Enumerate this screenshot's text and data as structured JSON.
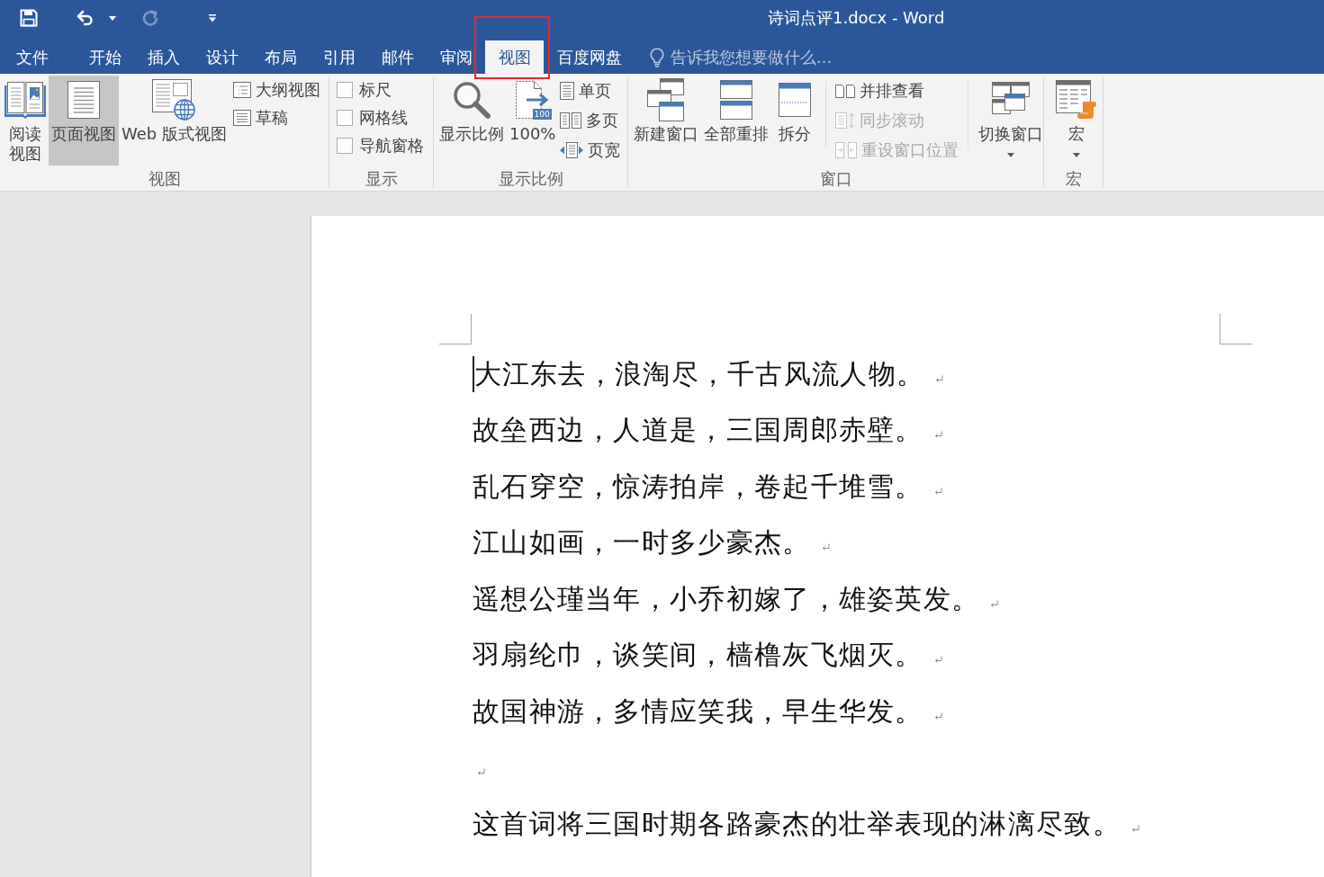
{
  "window": {
    "title": "诗词点评1.docx - Word"
  },
  "quick_access": [
    {
      "disabled": false
    },
    {
      "disabled": false
    },
    {
      "disabled": true
    }
  ],
  "tabs": [
    {
      "label": "文件",
      "selected": false,
      "highlighted": false
    },
    {
      "label": "开始",
      "selected": false,
      "highlighted": false
    },
    {
      "label": "插入",
      "selected": false,
      "highlighted": false
    },
    {
      "label": "设计",
      "selected": false,
      "highlighted": false
    },
    {
      "label": "布局",
      "selected": false,
      "highlighted": false
    },
    {
      "label": "引用",
      "selected": false,
      "highlighted": false
    },
    {
      "label": "邮件",
      "selected": false,
      "highlighted": false
    },
    {
      "label": "审阅",
      "selected": false,
      "highlighted": false
    },
    {
      "label": "视图",
      "selected": true,
      "highlighted": true
    },
    {
      "label": "百度网盘",
      "selected": false,
      "highlighted": false
    }
  ],
  "tell_me": {
    "placeholder": "告诉我您想要做什么..."
  },
  "ribbon": {
    "groups": [
      {
        "label": "视图",
        "items": [
          {
            "kind": "large",
            "label": "阅读视图",
            "selected": false
          },
          {
            "kind": "large",
            "label": "页面视图",
            "selected": true
          },
          {
            "kind": "large",
            "label": "Web 版式视图",
            "selected": false
          },
          {
            "kind": "small",
            "label": "大纲视图",
            "selected": false
          },
          {
            "kind": "small",
            "label": "草稿",
            "selected": false
          }
        ]
      },
      {
        "label": "显示",
        "items": [
          {
            "kind": "checkbox",
            "label": "标尺",
            "checked": false
          },
          {
            "kind": "checkbox",
            "label": "网格线",
            "checked": false
          },
          {
            "kind": "checkbox",
            "label": "导航窗格",
            "checked": false
          }
        ]
      },
      {
        "label": "显示比例",
        "items": [
          {
            "kind": "large",
            "label": "显示比例"
          },
          {
            "kind": "large",
            "label": "100%",
            "badge": "100"
          },
          {
            "kind": "small",
            "label": "单页"
          },
          {
            "kind": "small",
            "label": "多页"
          },
          {
            "kind": "small",
            "label": "页宽"
          }
        ]
      },
      {
        "label": "窗口",
        "items": [
          {
            "kind": "large",
            "label": "新建窗口",
            "disabled": false
          },
          {
            "kind": "large",
            "label": "全部重排",
            "disabled": false
          },
          {
            "kind": "large",
            "label": "拆分",
            "disabled": false
          },
          {
            "kind": "small",
            "label": "并排查看",
            "disabled": false
          },
          {
            "kind": "small",
            "label": "同步滚动",
            "disabled": true
          },
          {
            "kind": "small",
            "label": "重设窗口位置",
            "disabled": true
          },
          {
            "kind": "menu",
            "label": "切换窗口",
            "disabled": false
          }
        ]
      },
      {
        "label": "宏",
        "items": [
          {
            "kind": "menu",
            "label": "宏"
          }
        ]
      }
    ]
  },
  "document": {
    "paragraphs": [
      {
        "kind": "text",
        "text": "大江东去，浪淘尽，千古风流人物。",
        "cursor": true
      },
      {
        "kind": "text",
        "text": "故垒西边，人道是，三国周郎赤壁。",
        "cursor": false
      },
      {
        "kind": "text",
        "text": "乱石穿空，惊涛拍岸，卷起千堆雪。",
        "cursor": false
      },
      {
        "kind": "text",
        "text": "江山如画，一时多少豪杰。",
        "cursor": false
      },
      {
        "kind": "text",
        "text": "遥想公瑾当年，小乔初嫁了，雄姿英发。",
        "cursor": false
      },
      {
        "kind": "text",
        "text": "羽扇纶巾，谈笑间，樯橹灰飞烟灭。",
        "cursor": false
      },
      {
        "kind": "text",
        "text": "故国神游，多情应笑我，早生华发。",
        "cursor": false
      },
      {
        "kind": "blank",
        "cursor": false
      },
      {
        "kind": "text",
        "text": "这首词将三国时期各路豪杰的壮举表现的淋漓尽致。",
        "cursor": false
      }
    ]
  }
}
